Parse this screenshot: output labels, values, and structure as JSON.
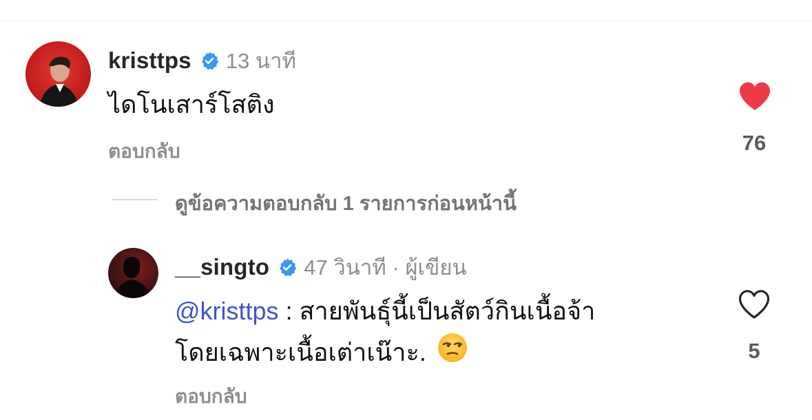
{
  "comments": [
    {
      "username": "kristtps",
      "time": "13 นาที",
      "text": "ไดโนเสาร์โสติง",
      "reply_label": "ตอบกลับ",
      "likes": "76",
      "liked": true
    },
    {
      "username": "__singto",
      "time": "47 วินาที · ผู้เขียน",
      "mention": "@kristtps",
      "text_line1": " : สายพันธุ์นี้เป็นสัตว์กินเนื้อจ้า",
      "text_line2": "โดยเฉพาะเนื้อเต่าเน๊าะ.",
      "reply_label": "ตอบกลับ",
      "likes": "5",
      "liked": false
    }
  ],
  "view_replies_label": "ดูข้อความตอบกลับ 1 รายการก่อนหน้านี้",
  "colors": {
    "heart_liked": "#ed3a48",
    "verified": "#3a97f0",
    "mention": "#3e54c6"
  },
  "icons": [
    "verified-badge-icon",
    "heart-filled-icon",
    "heart-outline-icon",
    "unamused-face-emoji"
  ]
}
